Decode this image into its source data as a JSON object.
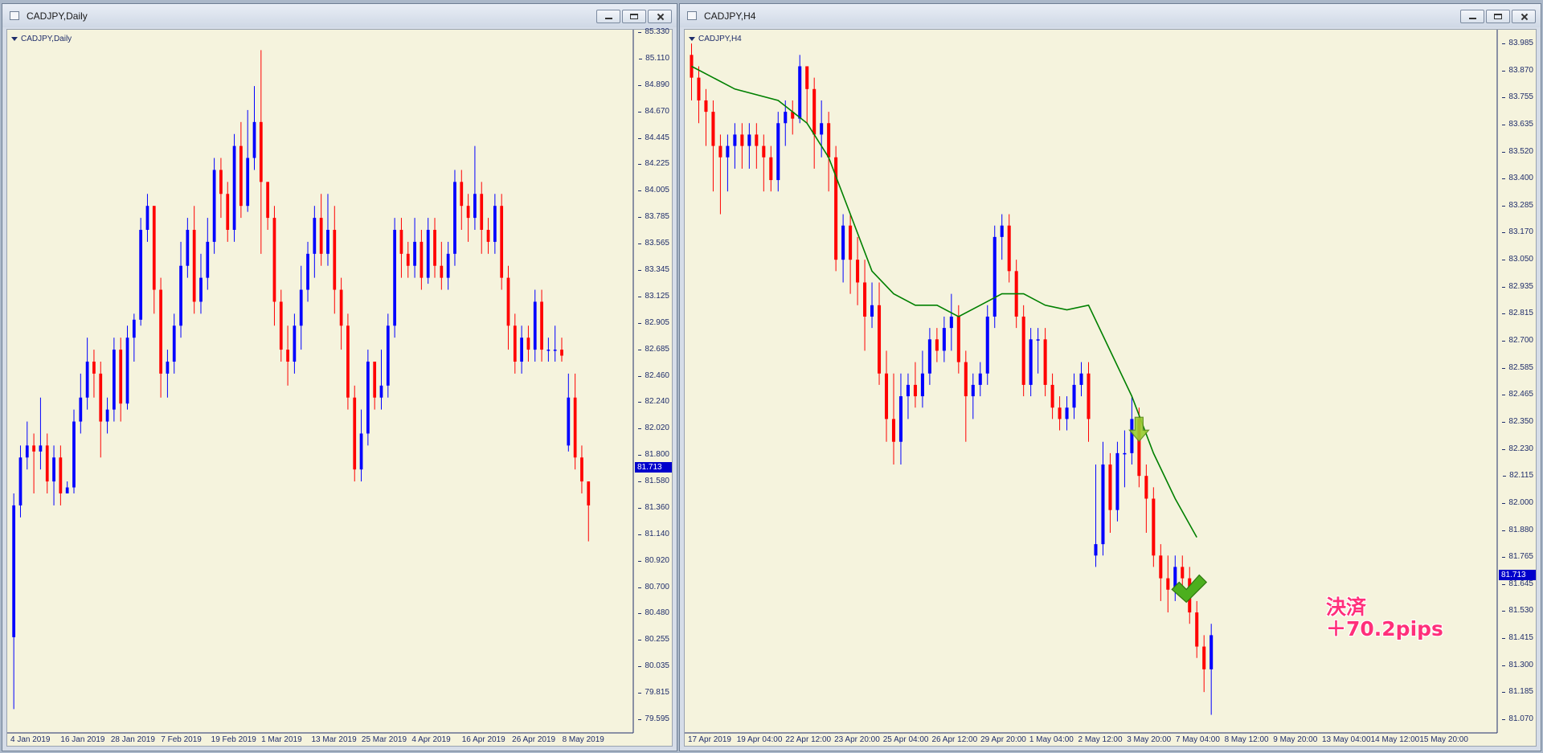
{
  "colors": {
    "bull": "#0000ff",
    "bear": "#ff0000",
    "ma": "#008000",
    "background": "#f5f3dd",
    "annotation": "#ff2f7a"
  },
  "windows": [
    {
      "title": "CADJPY,Daily",
      "chart_label": "CADJPY,Daily",
      "icon": "chart-window-icon",
      "current_price": "81.713",
      "price_ticks": [
        "85.330",
        "85.110",
        "84.890",
        "84.670",
        "84.445",
        "84.225",
        "84.005",
        "83.785",
        "83.565",
        "83.345",
        "83.125",
        "82.905",
        "82.685",
        "82.460",
        "82.240",
        "82.020",
        "81.800",
        "81.580",
        "81.360",
        "81.140",
        "80.920",
        "80.700",
        "80.480",
        "80.255",
        "80.035",
        "79.815",
        "79.595"
      ],
      "date_ticks": [
        "4 Jan 2019",
        "16 Jan 2019",
        "28 Jan 2019",
        "7 Feb 2019",
        "19 Feb 2019",
        "1 Mar 2019",
        "13 Mar 2019",
        "25 Mar 2019",
        "4 Apr 2019",
        "16 Apr 2019",
        "26 Apr 2019",
        "8 May 2019"
      ]
    },
    {
      "title": "CADJPY,H4",
      "chart_label": "CADJPY,H4",
      "icon": "chart-window-icon",
      "current_price": "81.713",
      "price_ticks": [
        "83.985",
        "83.870",
        "83.755",
        "83.635",
        "83.520",
        "83.400",
        "83.285",
        "83.170",
        "83.050",
        "82.935",
        "82.815",
        "82.700",
        "82.585",
        "82.465",
        "82.350",
        "82.230",
        "82.115",
        "82.000",
        "81.880",
        "81.765",
        "81.645",
        "81.530",
        "81.415",
        "81.300",
        "81.185",
        "81.070"
      ],
      "date_ticks": [
        "17 Apr 2019",
        "19 Apr 04:00",
        "22 Apr 12:00",
        "23 Apr 20:00",
        "25 Apr 04:00",
        "26 Apr 12:00",
        "29 Apr 20:00",
        "1 May 04:00",
        "2 May 12:00",
        "3 May 20:00",
        "7 May 04:00",
        "8 May 12:00",
        "9 May 20:00",
        "13 May 04:00",
        "14 May 12:00",
        "15 May 20:00"
      ],
      "annotation": {
        "line1": "決済",
        "line2": "＋70.2pips"
      },
      "markers": {
        "entry": "arrow-down-icon",
        "exit": "checkmark-icon"
      }
    }
  ],
  "chart_data": [
    {
      "type": "candlestick",
      "symbol": "CADJPY",
      "timeframe": "Daily",
      "ylim": [
        79.595,
        85.33
      ],
      "candles": [
        [
          80.3,
          81.4,
          79.7,
          81.5
        ],
        [
          81.4,
          81.8,
          81.3,
          81.9
        ],
        [
          81.8,
          81.9,
          81.7,
          82.1
        ],
        [
          81.9,
          81.85,
          81.5,
          82.0
        ],
        [
          81.85,
          81.9,
          81.7,
          82.3
        ],
        [
          81.9,
          81.6,
          81.5,
          82.0
        ],
        [
          81.6,
          81.8,
          81.4,
          81.9
        ],
        [
          81.8,
          81.5,
          81.4,
          81.9
        ],
        [
          81.5,
          81.55,
          81.5,
          81.6
        ],
        [
          81.55,
          82.1,
          81.5,
          82.2
        ],
        [
          82.1,
          82.3,
          82.0,
          82.5
        ],
        [
          82.3,
          82.6,
          82.2,
          82.8
        ],
        [
          82.6,
          82.5,
          82.3,
          82.7
        ],
        [
          82.5,
          82.1,
          81.8,
          82.6
        ],
        [
          82.1,
          82.2,
          82.0,
          82.3
        ],
        [
          82.2,
          82.7,
          82.1,
          82.8
        ],
        [
          82.7,
          82.25,
          82.1,
          82.8
        ],
        [
          82.25,
          82.8,
          82.2,
          82.9
        ],
        [
          82.8,
          82.95,
          82.6,
          83.0
        ],
        [
          82.95,
          83.7,
          82.9,
          83.8
        ],
        [
          83.7,
          83.9,
          83.6,
          84.0
        ],
        [
          83.9,
          83.2,
          83.0,
          83.9
        ],
        [
          83.2,
          82.5,
          82.3,
          83.3
        ],
        [
          82.5,
          82.6,
          82.3,
          82.7
        ],
        [
          82.6,
          82.9,
          82.5,
          83.0
        ],
        [
          82.9,
          83.4,
          82.8,
          83.6
        ],
        [
          83.4,
          83.7,
          83.3,
          83.8
        ],
        [
          83.7,
          83.1,
          83.0,
          83.9
        ],
        [
          83.1,
          83.3,
          83.0,
          83.5
        ],
        [
          83.3,
          83.6,
          83.2,
          83.8
        ],
        [
          83.6,
          84.2,
          83.5,
          84.3
        ],
        [
          84.2,
          84.0,
          83.8,
          84.3
        ],
        [
          84.0,
          83.7,
          83.6,
          84.1
        ],
        [
          83.7,
          84.4,
          83.6,
          84.5
        ],
        [
          84.4,
          83.9,
          83.8,
          84.6
        ],
        [
          83.9,
          84.3,
          83.85,
          84.7
        ],
        [
          84.3,
          84.6,
          84.2,
          84.9
        ],
        [
          84.6,
          84.1,
          83.5,
          85.2
        ],
        [
          84.1,
          83.8,
          83.7,
          84.1
        ],
        [
          83.8,
          83.1,
          82.9,
          83.9
        ],
        [
          83.1,
          82.7,
          82.6,
          83.2
        ],
        [
          82.7,
          82.6,
          82.4,
          82.9
        ],
        [
          82.6,
          82.9,
          82.5,
          83.0
        ],
        [
          82.9,
          83.2,
          82.7,
          83.4
        ],
        [
          83.2,
          83.5,
          83.1,
          83.6
        ],
        [
          83.5,
          83.8,
          83.3,
          83.9
        ],
        [
          83.8,
          83.5,
          83.4,
          84.0
        ],
        [
          83.5,
          83.7,
          83.4,
          84.0
        ],
        [
          83.7,
          83.2,
          83.0,
          83.9
        ],
        [
          83.2,
          82.9,
          82.7,
          83.3
        ],
        [
          82.9,
          82.3,
          82.2,
          83.0
        ],
        [
          82.3,
          81.7,
          81.6,
          82.4
        ],
        [
          81.7,
          82.0,
          81.6,
          82.2
        ],
        [
          82.0,
          82.6,
          81.9,
          82.7
        ],
        [
          82.6,
          82.3,
          82.2,
          82.6
        ],
        [
          82.3,
          82.4,
          82.2,
          82.7
        ],
        [
          82.4,
          82.9,
          82.3,
          83.0
        ],
        [
          82.9,
          83.7,
          82.8,
          83.8
        ],
        [
          83.7,
          83.5,
          83.3,
          83.8
        ],
        [
          83.5,
          83.4,
          83.3,
          83.6
        ],
        [
          83.4,
          83.6,
          83.3,
          83.8
        ],
        [
          83.6,
          83.3,
          83.2,
          83.7
        ],
        [
          83.3,
          83.7,
          83.25,
          83.8
        ],
        [
          83.7,
          83.4,
          83.3,
          83.8
        ],
        [
          83.4,
          83.3,
          83.2,
          83.6
        ],
        [
          83.3,
          83.5,
          83.2,
          83.6
        ],
        [
          83.5,
          84.1,
          83.4,
          84.2
        ],
        [
          84.1,
          83.9,
          83.7,
          84.2
        ],
        [
          83.9,
          83.8,
          83.6,
          84.0
        ],
        [
          83.8,
          84.0,
          83.7,
          84.4
        ],
        [
          84.0,
          83.7,
          83.5,
          84.1
        ],
        [
          83.7,
          83.6,
          83.5,
          83.8
        ],
        [
          83.6,
          83.9,
          83.5,
          84.0
        ],
        [
          83.9,
          83.3,
          83.2,
          84.0
        ],
        [
          83.3,
          82.9,
          82.7,
          83.4
        ],
        [
          82.9,
          82.6,
          82.5,
          83.0
        ],
        [
          82.6,
          82.8,
          82.5,
          82.9
        ],
        [
          82.8,
          82.7,
          82.6,
          82.9
        ],
        [
          82.7,
          83.1,
          82.6,
          83.2
        ],
        [
          83.1,
          82.7,
          82.6,
          83.2
        ],
        [
          82.7,
          82.7,
          82.6,
          82.8
        ],
        [
          82.7,
          82.7,
          82.6,
          82.9
        ],
        [
          82.7,
          82.65,
          82.6,
          82.8
        ],
        [
          81.9,
          82.3,
          81.85,
          82.5
        ],
        [
          82.3,
          81.8,
          81.7,
          82.5
        ],
        [
          81.8,
          81.6,
          81.5,
          81.9
        ],
        [
          81.6,
          81.4,
          81.1,
          81.6
        ]
      ]
    },
    {
      "type": "candlestick",
      "symbol": "CADJPY",
      "timeframe": "H4",
      "ylim": [
        81.07,
        84.04
      ],
      "candles": [
        [
          84.0,
          83.9,
          83.8,
          84.05
        ],
        [
          83.9,
          83.8,
          83.7,
          83.95
        ],
        [
          83.8,
          83.75,
          83.6,
          83.85
        ],
        [
          83.75,
          83.6,
          83.4,
          83.8
        ],
        [
          83.6,
          83.55,
          83.3,
          83.65
        ],
        [
          83.55,
          83.6,
          83.4,
          83.65
        ],
        [
          83.6,
          83.65,
          83.5,
          83.7
        ],
        [
          83.65,
          83.6,
          83.5,
          83.7
        ],
        [
          83.6,
          83.65,
          83.5,
          83.7
        ],
        [
          83.65,
          83.6,
          83.5,
          83.7
        ],
        [
          83.6,
          83.55,
          83.4,
          83.65
        ],
        [
          83.55,
          83.45,
          83.4,
          83.6
        ],
        [
          83.45,
          83.7,
          83.4,
          83.75
        ],
        [
          83.7,
          83.75,
          83.6,
          83.8
        ],
        [
          83.75,
          83.72,
          83.65,
          83.8
        ],
        [
          83.72,
          83.95,
          83.7,
          84.0
        ],
        [
          83.95,
          83.85,
          83.7,
          83.95
        ],
        [
          83.85,
          83.65,
          83.5,
          83.9
        ],
        [
          83.65,
          83.7,
          83.55,
          83.8
        ],
        [
          83.7,
          83.55,
          83.4,
          83.75
        ],
        [
          83.55,
          83.1,
          83.05,
          83.6
        ],
        [
          83.1,
          83.25,
          83.0,
          83.3
        ],
        [
          83.25,
          83.1,
          82.95,
          83.3
        ],
        [
          83.1,
          83.0,
          82.9,
          83.2
        ],
        [
          83.0,
          82.85,
          82.7,
          83.1
        ],
        [
          82.85,
          82.9,
          82.8,
          83.0
        ],
        [
          82.9,
          82.6,
          82.55,
          83.0
        ],
        [
          82.6,
          82.4,
          82.3,
          82.7
        ],
        [
          82.4,
          82.3,
          82.2,
          82.6
        ],
        [
          82.3,
          82.5,
          82.2,
          82.6
        ],
        [
          82.5,
          82.55,
          82.4,
          82.6
        ],
        [
          82.55,
          82.5,
          82.45,
          82.65
        ],
        [
          82.5,
          82.6,
          82.45,
          82.7
        ],
        [
          82.6,
          82.75,
          82.55,
          82.8
        ],
        [
          82.75,
          82.7,
          82.65,
          82.8
        ],
        [
          82.7,
          82.8,
          82.65,
          82.85
        ],
        [
          82.8,
          82.85,
          82.7,
          82.95
        ],
        [
          82.85,
          82.65,
          82.6,
          82.9
        ],
        [
          82.65,
          82.5,
          82.3,
          82.7
        ],
        [
          82.5,
          82.55,
          82.4,
          82.6
        ],
        [
          82.55,
          82.6,
          82.5,
          82.65
        ],
        [
          82.6,
          82.85,
          82.55,
          82.9
        ],
        [
          82.85,
          83.2,
          82.8,
          83.25
        ],
        [
          83.2,
          83.25,
          83.1,
          83.3
        ],
        [
          83.25,
          83.05,
          83.0,
          83.3
        ],
        [
          83.05,
          82.85,
          82.8,
          83.1
        ],
        [
          82.85,
          82.55,
          82.5,
          82.9
        ],
        [
          82.55,
          82.75,
          82.5,
          82.8
        ],
        [
          82.75,
          82.75,
          82.6,
          82.8
        ],
        [
          82.75,
          82.55,
          82.5,
          82.8
        ],
        [
          82.55,
          82.45,
          82.4,
          82.6
        ],
        [
          82.45,
          82.4,
          82.35,
          82.5
        ],
        [
          82.4,
          82.45,
          82.35,
          82.5
        ],
        [
          82.45,
          82.55,
          82.4,
          82.6
        ],
        [
          82.55,
          82.6,
          82.5,
          82.65
        ],
        [
          82.6,
          82.4,
          82.3,
          82.65
        ],
        [
          81.8,
          81.85,
          81.75,
          82.2
        ],
        [
          81.85,
          82.2,
          81.8,
          82.3
        ],
        [
          82.2,
          82.0,
          81.9,
          82.25
        ],
        [
          82.0,
          82.25,
          81.95,
          82.3
        ],
        [
          82.25,
          82.25,
          82.1,
          82.35
        ],
        [
          82.25,
          82.4,
          82.2,
          82.5
        ],
        [
          82.4,
          82.15,
          82.1,
          82.45
        ],
        [
          82.15,
          82.05,
          81.9,
          82.2
        ],
        [
          82.05,
          81.8,
          81.75,
          82.1
        ],
        [
          81.8,
          81.7,
          81.6,
          81.85
        ],
        [
          81.7,
          81.65,
          81.55,
          81.8
        ],
        [
          81.65,
          81.75,
          81.6,
          81.8
        ],
        [
          81.75,
          81.7,
          81.65,
          81.8
        ],
        [
          81.7,
          81.55,
          81.5,
          81.75
        ],
        [
          81.55,
          81.4,
          81.35,
          81.6
        ],
        [
          81.4,
          81.3,
          81.2,
          81.45
        ],
        [
          81.3,
          81.45,
          81.1,
          81.5
        ]
      ],
      "moving_average": [
        [
          0,
          83.95
        ],
        [
          6,
          83.85
        ],
        [
          12,
          83.8
        ],
        [
          16,
          83.7
        ],
        [
          19,
          83.55
        ],
        [
          22,
          83.3
        ],
        [
          25,
          83.05
        ],
        [
          28,
          82.95
        ],
        [
          31,
          82.9
        ],
        [
          34,
          82.9
        ],
        [
          37,
          82.85
        ],
        [
          40,
          82.9
        ],
        [
          43,
          82.95
        ],
        [
          46,
          82.95
        ],
        [
          49,
          82.9
        ],
        [
          52,
          82.88
        ],
        [
          55,
          82.9
        ],
        [
          58,
          82.7
        ],
        [
          61,
          82.5
        ],
        [
          64,
          82.25
        ],
        [
          67,
          82.05
        ],
        [
          70,
          81.88
        ]
      ],
      "entry_index": 62,
      "exit_index": 69
    }
  ]
}
